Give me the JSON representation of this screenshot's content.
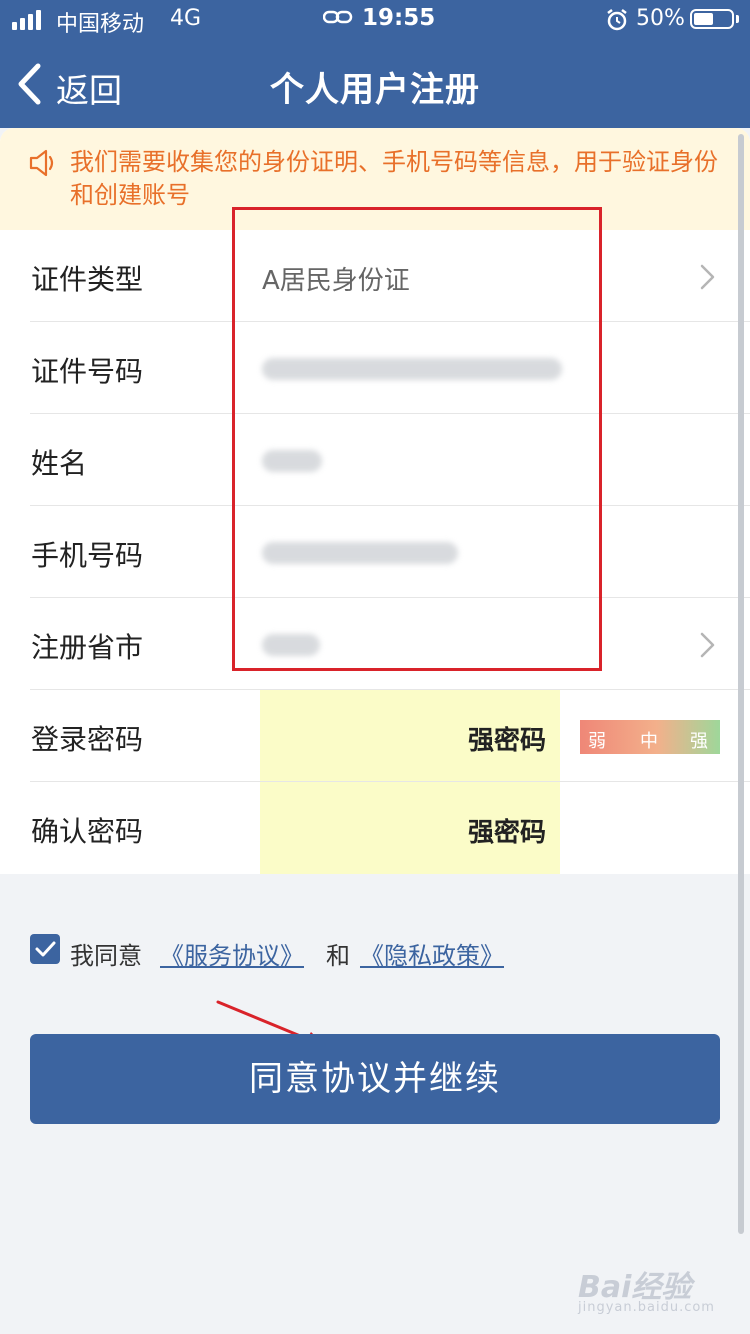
{
  "status_bar": {
    "carrier": "中国移动",
    "network": "4G",
    "time": "19:55",
    "battery": "50%",
    "battery_level": 0.5
  },
  "nav": {
    "back_label": "返回",
    "title": "个人用户注册"
  },
  "notice": {
    "text": "我们需要收集您的身份证明、手机号码等信息，用于验证身份和创建账号"
  },
  "form": {
    "rows": [
      {
        "label": "证件类型",
        "value": "A居民身份证"
      },
      {
        "label": "证件号码"
      },
      {
        "label": "姓名"
      },
      {
        "label": "手机号码"
      },
      {
        "label": "注册省市"
      },
      {
        "label": "登录密码",
        "value": "强密码"
      },
      {
        "label": "确认密码",
        "value": "强密码"
      }
    ],
    "strength": {
      "weak": "弱",
      "medium": "中",
      "strong": "强"
    }
  },
  "agreement": {
    "prefix": "我同意",
    "service": "《服务协议》",
    "and": "和",
    "privacy": "《隐私政策》",
    "checked": true
  },
  "submit_label": "同意协议并继续",
  "watermark": {
    "brand": "Bai经验",
    "url": "jingyan.baidu.com"
  },
  "colors": {
    "primary": "#3c64a0",
    "notice_text": "#e8702a",
    "notice_bg": "#fff7df",
    "password_highlight": "#fbfcc8",
    "annotation_red": "#d9232a"
  }
}
